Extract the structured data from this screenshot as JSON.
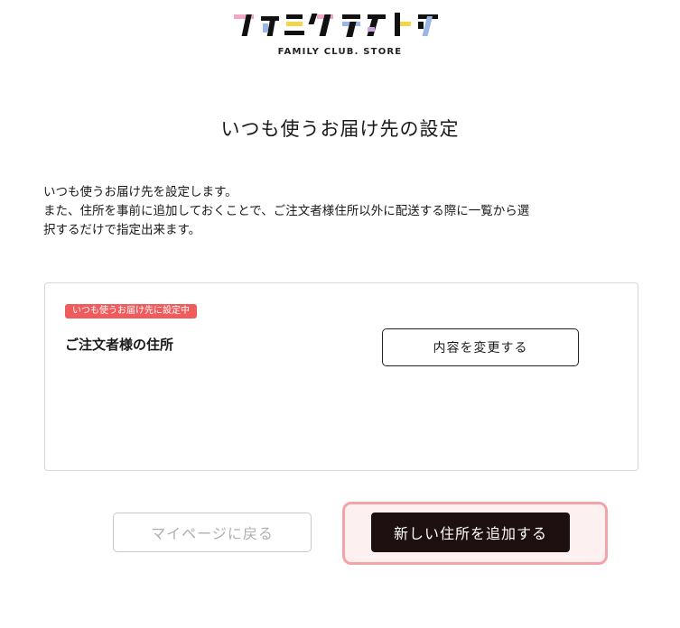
{
  "header": {
    "logo_text": "ファミクラストア",
    "logo_sub": "FAMILY CLUB. STORE"
  },
  "page": {
    "title": "いつも使うお届け先の設定",
    "description_line1": "いつも使うお届け先を設定します。",
    "description_line2": "また、住所を事前に追加しておくことで、ご注文者様住所以外に配送する際に一覧から選",
    "description_line3": "択するだけで指定出来ます。"
  },
  "address_card": {
    "badge": "いつも使うお届け先に設定中",
    "name": "ご注文者様の住所",
    "edit_label": "内容を変更する"
  },
  "actions": {
    "back_label": "マイページに戻る",
    "add_label": "新しい住所を追加する"
  },
  "colors": {
    "badge": "#f05c5c",
    "primary_button": "#1e0f10",
    "highlight_border": "#f4a3a8"
  }
}
